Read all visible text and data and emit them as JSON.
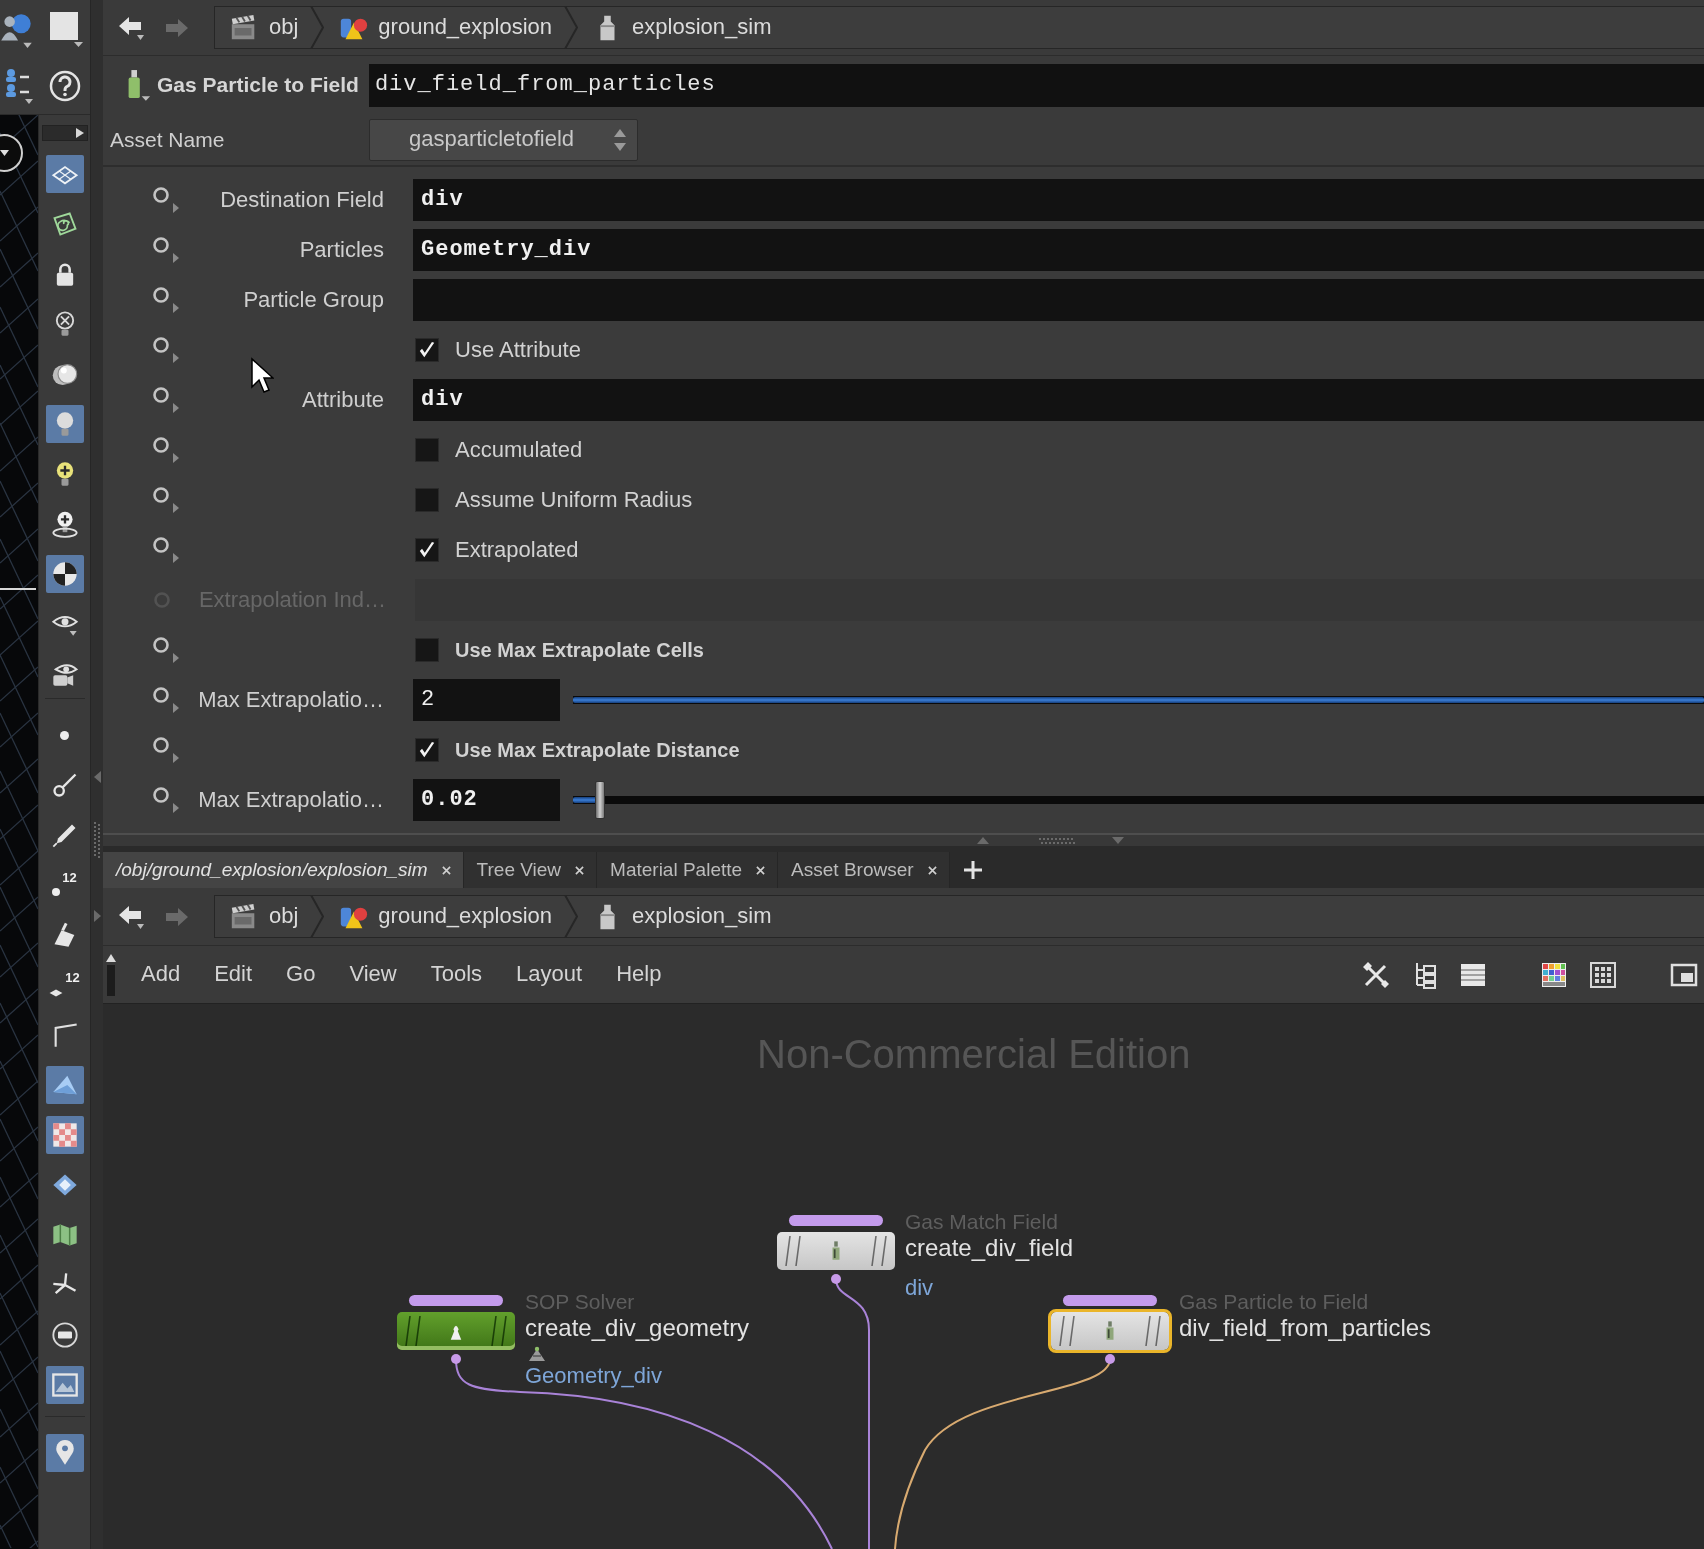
{
  "left_toolbar": {
    "groups": [
      {
        "tools": [
          {
            "kind": "plane",
            "on": true
          },
          {
            "kind": "spiral",
            "on": false
          },
          {
            "kind": "lock",
            "on": false
          },
          {
            "kind": "nolight",
            "on": false
          },
          {
            "kind": "spheres",
            "on": false
          },
          {
            "kind": "bulb",
            "on": true
          },
          {
            "kind": "bulbplus",
            "on": false
          },
          {
            "kind": "lamp",
            "on": false
          },
          {
            "kind": "ball",
            "on": true
          },
          {
            "kind": "eye",
            "on": false
          },
          {
            "kind": "camera",
            "on": false
          }
        ]
      },
      {
        "tools": [
          {
            "kind": "dot",
            "on": false
          },
          {
            "kind": "needle",
            "on": false
          },
          {
            "kind": "pen",
            "on": false
          },
          {
            "kind": "pointnumber",
            "on": false,
            "label": "12"
          },
          {
            "kind": "brush",
            "on": false
          },
          {
            "kind": "primnumber",
            "on": false,
            "label": "12"
          },
          {
            "kind": "angle",
            "on": false
          },
          {
            "kind": "shard",
            "on": true
          },
          {
            "kind": "checker",
            "on": true
          },
          {
            "kind": "diamond",
            "on": false
          },
          {
            "kind": "map",
            "on": false
          },
          {
            "kind": "junction",
            "on": false
          },
          {
            "kind": "disc",
            "on": false
          },
          {
            "kind": "picture",
            "on": true
          }
        ]
      },
      {
        "tools": [
          {
            "kind": "pin",
            "on": true
          }
        ]
      }
    ]
  },
  "parameter_pane": {
    "breadcrumbs": [
      {
        "kind": "obj",
        "label": "obj"
      },
      {
        "kind": "geo",
        "label": "ground_explosion"
      },
      {
        "kind": "dop",
        "label": "explosion_sim"
      }
    ],
    "node_type": "Gas Particle to Field",
    "node_name": "div_field_from_particles",
    "asset_name": {
      "label": "Asset Name",
      "value": "gasparticletofield"
    },
    "parameters": [
      {
        "kind": "field",
        "label": "Destination Field",
        "value": "div",
        "modified": true,
        "disabled": false
      },
      {
        "kind": "field",
        "label": "Particles",
        "value": "Geometry_div",
        "modified": true,
        "disabled": false
      },
      {
        "kind": "field",
        "label": "Particle Group",
        "modified": false,
        "disabled": false
      },
      {
        "kind": "toggle",
        "label": "Use Attribute",
        "checked": true,
        "modified": false,
        "disabled": false
      },
      {
        "kind": "field",
        "label": "Attribute",
        "value": "div",
        "modified": true,
        "disabled": false
      },
      {
        "kind": "toggle",
        "label": "Accumulated",
        "checked": false,
        "modified": false,
        "disabled": false
      },
      {
        "kind": "toggle",
        "label": "Assume Uniform Radius",
        "checked": false,
        "modified": false,
        "disabled": false
      },
      {
        "kind": "toggle",
        "label": "Extrapolated",
        "checked": true,
        "modified": false,
        "disabled": false
      },
      {
        "kind": "field",
        "label": "Extrapolation Ind…",
        "modified": false,
        "disabled": true
      },
      {
        "kind": "toggle",
        "label": "Use Max Extrapolate Cells",
        "checked": false,
        "modified": true,
        "disabled": false
      },
      {
        "kind": "slider",
        "label": "Max Extrapolatio…",
        "value": "2",
        "level": 1,
        "modified": false,
        "disabled": false
      },
      {
        "kind": "toggle",
        "label": "Use Max Extrapolate Distance",
        "checked": true,
        "modified": true,
        "disabled": false
      },
      {
        "kind": "slider",
        "label": "Max Extrapolatio…",
        "value": "0.02",
        "level": 0.024,
        "modified": true,
        "disabled": false
      }
    ]
  },
  "pane_tabs": [
    {
      "kind": "path",
      "label": "/obj/ground_explosion/explosion_sim",
      "selected": true
    },
    {
      "kind": "pane",
      "label": "Tree View",
      "selected": false
    },
    {
      "kind": "pane",
      "label": "Material Palette",
      "selected": false
    },
    {
      "kind": "pane",
      "label": "Asset Browser",
      "selected": false
    }
  ],
  "network_pane": {
    "breadcrumbs": [
      {
        "kind": "obj",
        "label": "obj"
      },
      {
        "kind": "geo",
        "label": "ground_explosion"
      },
      {
        "kind": "dop",
        "label": "explosion_sim"
      }
    ],
    "menu": [
      "Add",
      "Edit",
      "Go",
      "View",
      "Tools",
      "Layout",
      "Help"
    ],
    "edition_label": "Non-Commercial Edition",
    "nodes": [
      {
        "kind": "gas",
        "type": "Gas Match Field",
        "name": "create_div_field",
        "output_label": "div",
        "output_wired": true,
        "selected": false
      },
      {
        "kind": "sop",
        "type": "SOP Solver",
        "name": "create_div_geometry",
        "output_label": "Geometry_div",
        "output_wired": true,
        "selected": false
      },
      {
        "kind": "gas",
        "type": "Gas Particle to Field",
        "name": "div_field_from_particles",
        "output_wired": true,
        "selected": true
      }
    ]
  }
}
